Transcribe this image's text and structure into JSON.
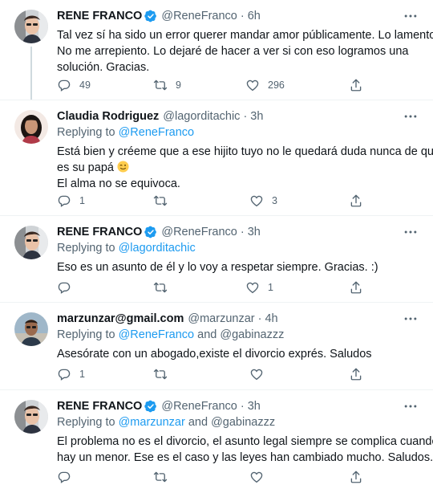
{
  "tweets": [
    {
      "name": "RENE FRANCO",
      "handle": "@ReneFranco",
      "time": "6h",
      "lines": [
        "Tal vez sí ha sido un error querer mandar amor públicamente. Lo lamento.",
        "No me arrepiento. Lo dejaré de hacer a ver si con eso logramos una",
        "solución. Gracias."
      ],
      "replies": "49",
      "retweets": "9",
      "likes": "296"
    },
    {
      "name": "Claudia Rodriguez",
      "handle": "@lagorditachic",
      "time": "3h",
      "replying_label": "Replying to",
      "replying_to": "@ReneFranco",
      "lines": [
        "Está bien y créeme que a ese hijito tuyo no le quedará duda nunca de quién",
        "es su papá",
        "El alma no se equivoca."
      ],
      "emoji": "winking-face",
      "replies": "1",
      "retweets": "",
      "likes": "3"
    },
    {
      "name": "RENE FRANCO",
      "handle": "@ReneFranco",
      "time": "3h",
      "replying_label": "Replying to",
      "replying_to": "@lagorditachic",
      "lines": [
        "Eso es un asunto de él y lo voy a respetar siempre. Gracias. :)"
      ],
      "replies": "",
      "retweets": "",
      "likes": "1"
    },
    {
      "name": "marzunzar@gmail.com",
      "handle": "@marzunzar",
      "time": "4h",
      "replying_label": "Replying to",
      "replying_to": "@ReneFranco",
      "and_label": "and",
      "replying_to_2": "@gabinazzz",
      "lines": [
        "Asesórate con un abogado,existe el divorcio exprés. Saludos"
      ],
      "replies": "1",
      "retweets": "",
      "likes": ""
    },
    {
      "name": "RENE FRANCO",
      "handle": "@ReneFranco",
      "time": "3h",
      "replying_label": "Replying to",
      "replying_to": "@marzunzar",
      "and_label": "and",
      "replying_to_2": "@gabinazzz",
      "lines": [
        "El problema no es el divorcio, el asunto legal siempre se complica cuando",
        "hay un menor. Ese es el caso y las leyes han cambiado mucho. Saludos."
      ],
      "replies": "",
      "retweets": "",
      "likes": ""
    }
  ],
  "colors": {
    "text": "#0f1419",
    "secondary": "#536471",
    "link": "#1d9bf0",
    "verified": "#1d9bf0",
    "divider": "#eff3f4"
  }
}
